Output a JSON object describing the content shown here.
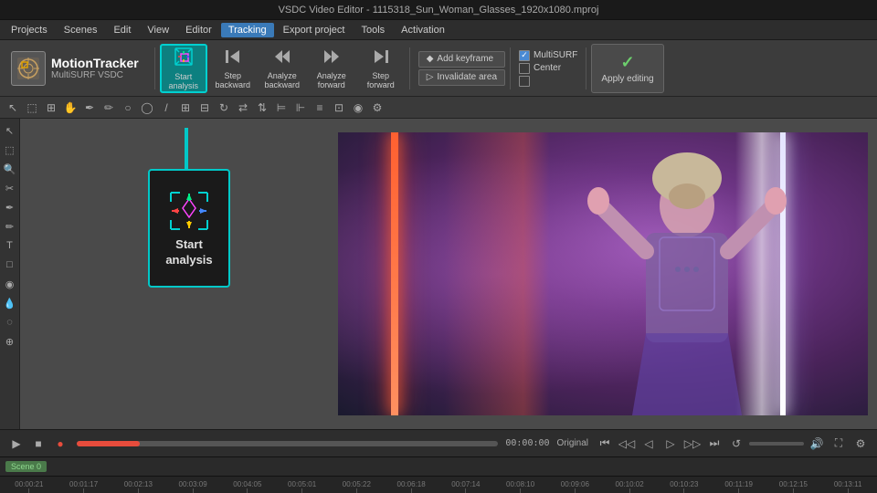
{
  "titleBar": {
    "text": "VSDC Video Editor - 1115318_Sun_Woman_Glasses_1920x1080.mproj"
  },
  "menuBar": {
    "items": [
      "Projects",
      "Scenes",
      "Edit",
      "View",
      "Editor",
      "Tracking",
      "Export project",
      "Tools",
      "Activation"
    ]
  },
  "toolbar": {
    "logo": {
      "title": "MotionTracker",
      "subtitle": "MultiSURF VSDC"
    },
    "buttons": [
      {
        "label": "Start analysis",
        "icon": "⊞",
        "highlighted": true
      },
      {
        "label": "Step backward",
        "icon": "⏮"
      },
      {
        "label": "Analyze backward",
        "icon": "◁◁"
      },
      {
        "label": "Analyze forward",
        "icon": "▷▷"
      },
      {
        "label": "Step forward",
        "icon": "⏭"
      }
    ],
    "rightButtons": [
      {
        "label": "Add keyframe",
        "icon": "◆"
      },
      {
        "label": "Invalidate area",
        "icon": "▷"
      }
    ],
    "multisurf": {
      "label": "MultiSURF",
      "center": "Center",
      "checkbox1_checked": true,
      "checkbox2_checked": false
    },
    "applyButton": {
      "check": "✓",
      "label": "Apply editing"
    }
  },
  "canvas": {
    "startAnalysisButton": {
      "label": "Start\nanalysis"
    }
  },
  "playerBar": {
    "timeDisplay": "00:00:00",
    "qualityLabel": "Original"
  },
  "sceneBar": {
    "label": "Scene 0"
  },
  "timeline": {
    "ticks": [
      "00:00:21",
      "00:01:17",
      "00:02:13",
      "00:03:09",
      "00:04:05",
      "00:05:01",
      "00:05:22",
      "00:06:18",
      "00:07:14",
      "00:08:10",
      "00:09:06",
      "00:10:02",
      "00:10:23",
      "00:11:19",
      "00:12:15",
      "00:13:11"
    ]
  }
}
